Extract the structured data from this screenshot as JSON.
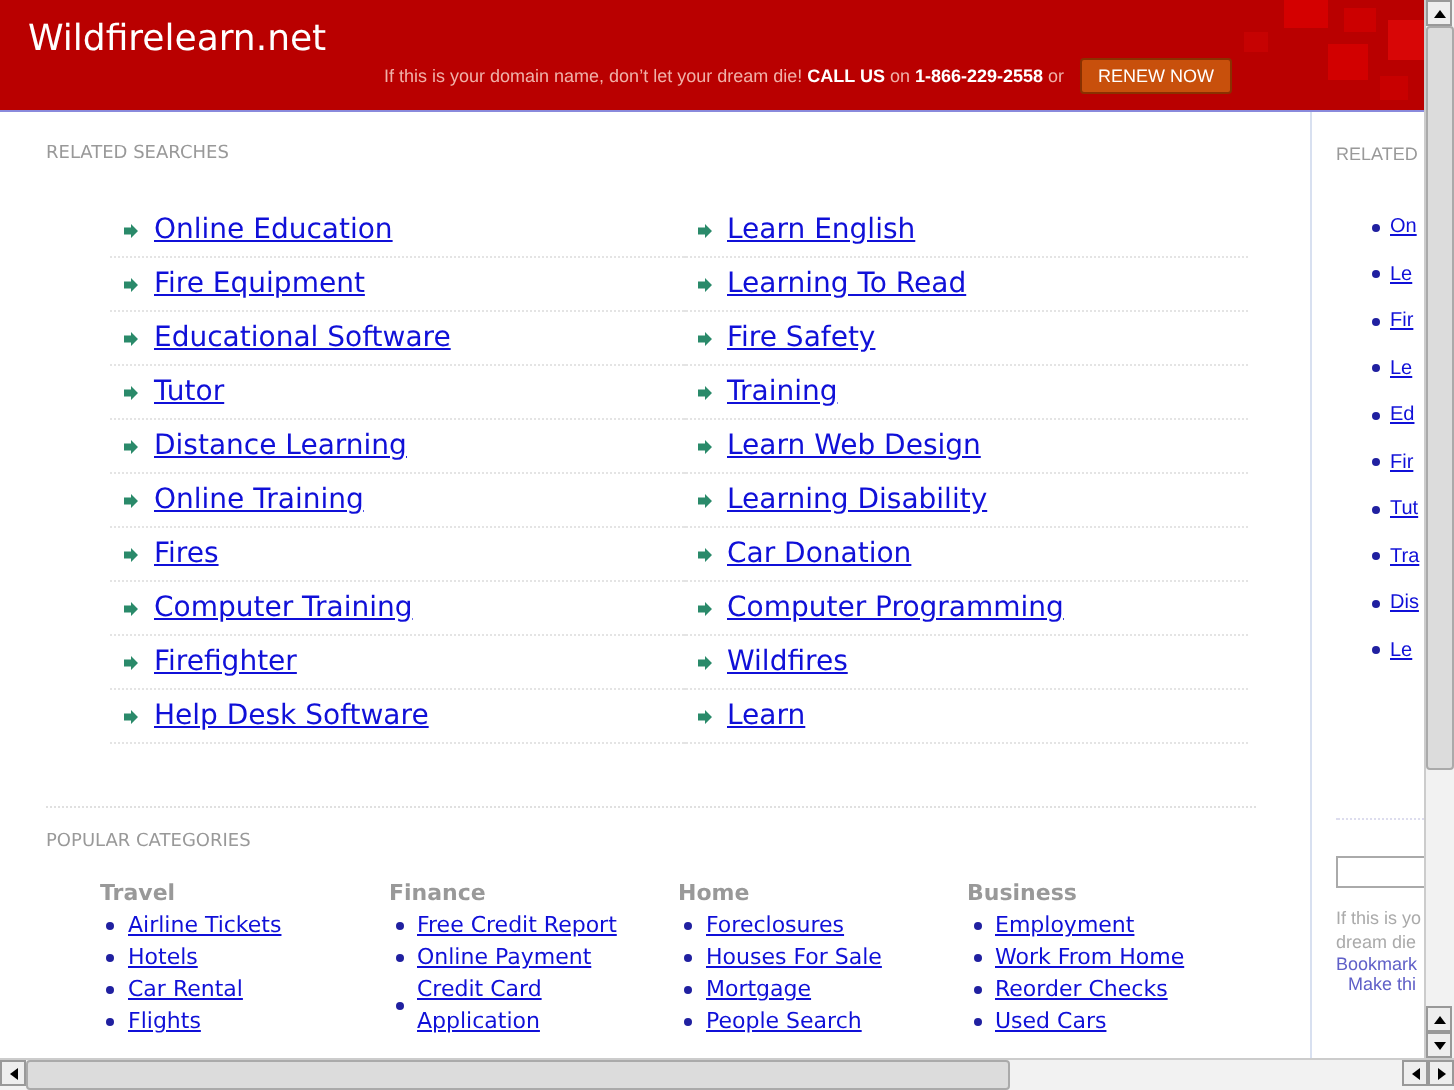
{
  "header": {
    "site_title": "Wildfirelearn.net",
    "promo_text": "If this is your domain name, don’t let your dream die! **CALL US** on **1-866-229-2558** or",
    "renew_button": "RENEW NOW"
  },
  "related_searches": {
    "heading": "RELATED SEARCHES",
    "columns": [
      [
        "Online Education",
        "Fire Equipment",
        "Educational Software",
        "Tutor",
        "Distance Learning",
        "Online Training",
        "Fires",
        "Computer Training",
        "Firefighter",
        "Help Desk Software"
      ],
      [
        "Learn English",
        "Learning To Read",
        "Fire Safety",
        "Training",
        "Learn Web Design",
        "Learning Disability",
        "Car Donation",
        "Computer Programming",
        "Wildfires",
        "Learn"
      ]
    ]
  },
  "popular_categories": {
    "heading": "POPULAR CATEGORIES",
    "categories": [
      {
        "title": "Travel",
        "links": [
          "Airline Tickets",
          "Hotels",
          "Car Rental",
          "Flights"
        ]
      },
      {
        "title": "Finance",
        "links": [
          "Free Credit Report",
          "Online Payment",
          "Credit Card Application"
        ]
      },
      {
        "title": "Home",
        "links": [
          "Foreclosures",
          "Houses For Sale",
          "Mortgage",
          "People Search"
        ]
      },
      {
        "title": "Business",
        "links": [
          "Employment",
          "Work From Home",
          "Reorder Checks",
          "Used Cars"
        ]
      }
    ]
  },
  "sidebar": {
    "heading": "RELATED",
    "links": [
      "On",
      "Le",
      "Fir",
      "Le",
      "Ed",
      "Fir",
      "Tut",
      "Tra",
      "Dis",
      "Le"
    ],
    "note_lines": [
      "If this is yo",
      "dream die"
    ],
    "bookmark_link": "Bookmark",
    "make_link": "Make thi"
  }
}
